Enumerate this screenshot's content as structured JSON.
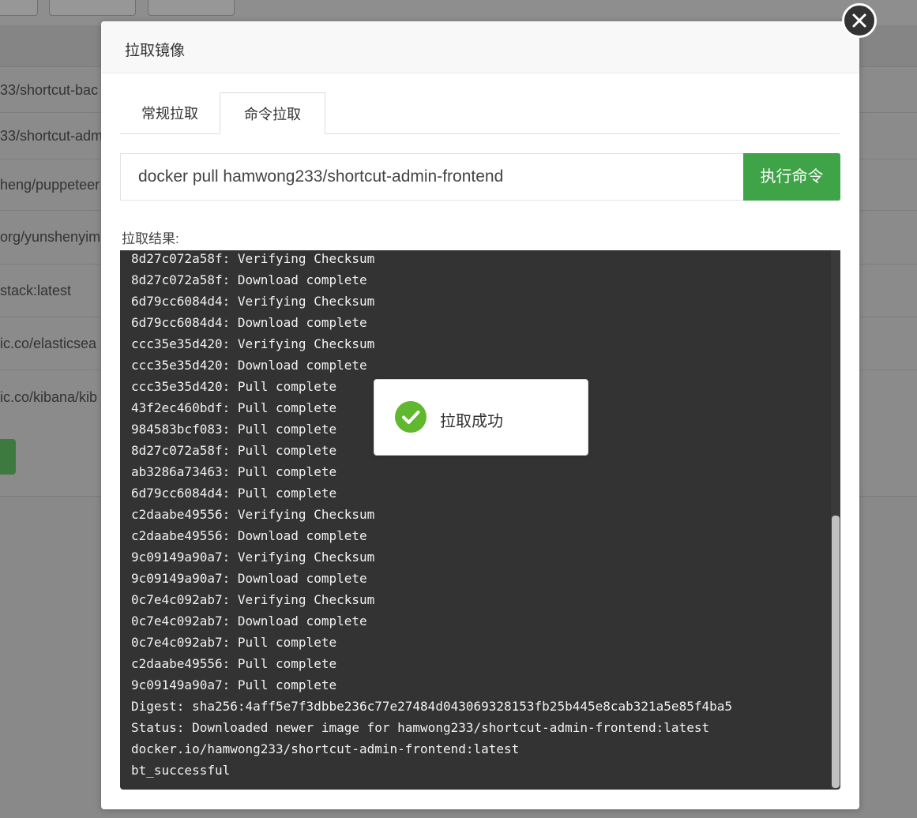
{
  "background": {
    "rows": [
      "33/shortcut-bac",
      "33/shortcut-adm",
      "heng/puppeteer",
      "org/yunshenyim",
      "stack:latest",
      "ic.co/elasticsea",
      "ic.co/kibana/kib"
    ]
  },
  "modal": {
    "title": "拉取镜像",
    "tabs": [
      {
        "label": "常规拉取",
        "active": false
      },
      {
        "label": "命令拉取",
        "active": true
      }
    ],
    "command_value": "docker pull hamwong233/shortcut-admin-frontend",
    "run_button_label": "执行命令",
    "result_label": "拉取结果:",
    "console_lines": [
      "8d27c072a58f: Verifying Checksum",
      "8d27c072a58f: Download complete",
      "6d79cc6084d4: Verifying Checksum",
      "6d79cc6084d4: Download complete",
      "ccc35e35d420: Verifying Checksum",
      "ccc35e35d420: Download complete",
      "ccc35e35d420: Pull complete",
      "43f2ec460bdf: Pull complete",
      "984583bcf083: Pull complete",
      "8d27c072a58f: Pull complete",
      "ab3286a73463: Pull complete",
      "6d79cc6084d4: Pull complete",
      "c2daabe49556: Verifying Checksum",
      "c2daabe49556: Download complete",
      "9c09149a90a7: Verifying Checksum",
      "9c09149a90a7: Download complete",
      "0c7e4c092ab7: Verifying Checksum",
      "0c7e4c092ab7: Download complete",
      "0c7e4c092ab7: Pull complete",
      "c2daabe49556: Pull complete",
      "9c09149a90a7: Pull complete",
      "Digest: sha256:4aff5e7f3dbbe236c77e27484d043069328153fb25b445e8cab321a5e85f4ba5",
      "Status: Downloaded newer image for hamwong233/shortcut-admin-frontend:latest",
      "docker.io/hamwong233/shortcut-admin-frontend:latest",
      "bt_successful"
    ]
  },
  "toast": {
    "message": "拉取成功",
    "icon": "check-circle-icon"
  },
  "colors": {
    "accent_green": "#3fa447",
    "console_bg": "#333333",
    "success_icon": "#5fb82e"
  }
}
